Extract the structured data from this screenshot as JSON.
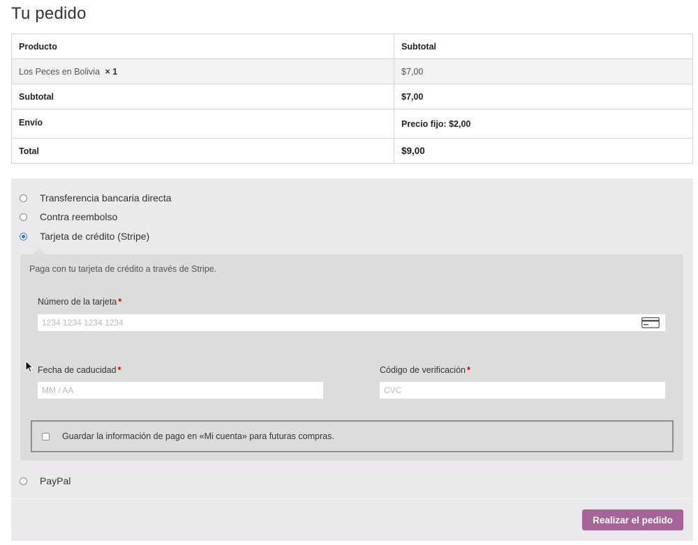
{
  "page": {
    "title": "Tu pedido"
  },
  "order_table": {
    "headers": {
      "product": "Producto",
      "subtotal": "Subtotal"
    },
    "item": {
      "name": "Los Peces en Bolivia",
      "qty": "× 1",
      "price": "$7,00"
    },
    "subtotal": {
      "label": "Subtotal",
      "value": "$7,00"
    },
    "shipping": {
      "label": "Envío",
      "value": "Precio fijo: $2,00"
    },
    "total": {
      "label": "Total",
      "value": "$9,00"
    }
  },
  "payment": {
    "methods": [
      {
        "label": "Transferencia bancaria directa",
        "checked": false
      },
      {
        "label": "Contra reembolso",
        "checked": false
      },
      {
        "label": "Tarjeta de crédito (Stripe)",
        "checked": true
      },
      {
        "label": "PayPal",
        "checked": false
      }
    ],
    "stripe": {
      "description": "Paga con tu tarjeta de crédito a través de Stripe.",
      "card_number_label": "Número de la tarjeta",
      "card_number_placeholder": "1234 1234 1234 1234",
      "expiry_label": "Fecha de caducidad",
      "expiry_placeholder": "MM / AA",
      "cvc_label": "Código de verificación",
      "cvc_placeholder": "CVC",
      "required_mark": "*",
      "card_icon": "credit-card-icon",
      "save_info_label": "Guardar la información de pago en «Mi cuenta» para futuras compras.",
      "save_info_checked": false
    },
    "place_order_label": "Realizar el pedido",
    "place_order_color": "#a46497"
  }
}
